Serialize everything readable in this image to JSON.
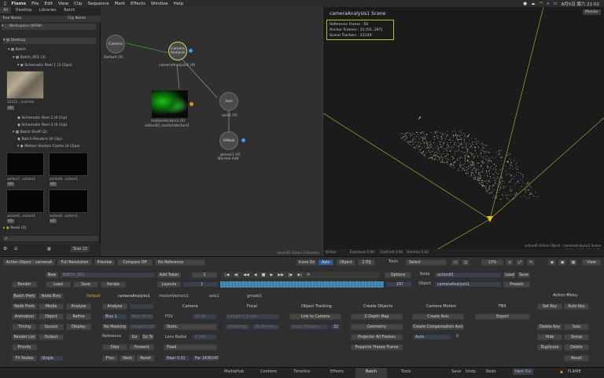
{
  "menubar": {
    "app": "Flame",
    "items": [
      "File",
      "Edit",
      "View",
      "Clip",
      "Sequence",
      "Mark",
      "Effects",
      "Window",
      "Help"
    ],
    "clock": "8月5日 周六 21:02"
  },
  "browser": {
    "tabs": [
      "All",
      "Desktop",
      "Libraries",
      "Batch"
    ],
    "col_tree": "Tree Name",
    "col_clip": "Clip Name",
    "workspace": "Workspace (WSW)",
    "desktop": "Desktop",
    "batch": "Batch",
    "batch_001": "Batch_001 (3)",
    "schematic_reel_1": "Schematic Reel 1 (3 Clips)",
    "clip_name_1": "22221...ircle-hd",
    "clip_tag_1": "HD",
    "schematic_reel_2": "Schematic Reel 2 (0 Clip)",
    "schematic_reel_3": "Schematic Reel 3 (0 Clip)",
    "batch_shelf": "Batch Shelf (2)",
    "batch_renders": "Batch Renders (0 Clip)",
    "motion_cache": "Motion Vectors Cache (4 Clips)",
    "thumbs": [
      {
        "label": "action7...ectors1",
        "tag": "HD"
      },
      {
        "label": "action8...ectors1",
        "tag": "HD"
      },
      {
        "label": "action6...ectors1",
        "tag": "HD"
      },
      {
        "label": "action6...ectors1",
        "tag": "HD"
      }
    ],
    "reels": "Reels (5)",
    "size_label": "Size 22"
  },
  "schematic": {
    "nodes": {
      "camera": "Camera",
      "camera_default": "Default (0)",
      "camera_analysis": "Camera Analysis",
      "camera_analysis_label": "cameraAnalysis1 (0)",
      "motion_label_1": "motionVectors1 (0)",
      "motion_label_2": "action81_motionVectors1",
      "axis": "Axis",
      "axis_label": "axis1 (0)",
      "gmask": "GMask",
      "gmask_label_1": "gmask1 (0)",
      "gmask_label_2": "Normal Add"
    },
    "footer": "action81 Action Schematic"
  },
  "viewer": {
    "title": "cameraAnalysis1 Scene",
    "monitor": "Monitor",
    "info_lines": [
      "Reference Frame : 50",
      "Anchor Frames : 21 [01..297]",
      "Scene Trackers : 22149"
    ],
    "footer_right_1": "action81 Action Object : cameraAnalysis1 Scene",
    "footer_right_2": "Shift • 1.98 | 13 | 1.71",
    "footer_left": "Action",
    "footer_exposure": "Exposure 0.00",
    "footer_contrast": "Contrast 1.00",
    "footer_gamma": "Gamma 1.00"
  },
  "toolbar": {
    "action_object": "Action Object : cameraA",
    "full_resolution": "Full Resolution",
    "preview": "Preview",
    "compare": "Compare Off",
    "no_reference": "No Reference",
    "icons_on": "Icons On",
    "axis": "Axis",
    "object": "Object",
    "two_d": "2 D/J",
    "tools": "Tools",
    "select": "Select",
    "zoom": "13%",
    "view": "View"
  },
  "batch_row": {
    "new": "New",
    "batch_name": "BATCH_001",
    "add_token": "Add Token",
    "frame": "1",
    "options": "Options",
    "node_label": "Node",
    "node_value": "action81",
    "load": "Load",
    "save": "Save",
    "render": "Render",
    "load2": "Load",
    "save2": "Save",
    "iterate": "Iterate",
    "layouts": "Layouts",
    "object_label": "Object",
    "object_value": "cameraAnalysis1",
    "presets": "Presets",
    "start_frame": "1",
    "end_frame": "297",
    "default_label": "Default"
  },
  "prefs_column": [
    "Batch Prefs",
    "Node Prefs",
    "Animation",
    "Timing",
    "Render List",
    "Priority",
    "FX Nodes"
  ],
  "prefs_col2": [
    "Node Bins",
    "Media",
    "Object",
    "Source",
    "Output"
  ],
  "prefs_col3": [
    "Analyse",
    "Refine",
    "Display"
  ],
  "fx_single": "Single",
  "tabs_row": {
    "tab_1": "cameraAnalysis1",
    "tab_2": "motionVectors1",
    "tab_3": "axis1",
    "tab_4": "gmask1"
  },
  "analysis": {
    "analyse": "Analyse",
    "bias": "Bias 1",
    "no_masking": "No Masking",
    "shape": "Shape 0.000",
    "reference": "Reference",
    "go": "Go",
    "goto": "Go To",
    "step": "Step",
    "forward": "Forward",
    "prev": "Prev",
    "next": "Next",
    "reset": "Reset",
    "max": "Max 10.00"
  },
  "camera": {
    "header": "Camera",
    "fov": "FOV",
    "fov_value": "42.00",
    "static": "Static",
    "lens_radial": "Lens Radial",
    "lens_value": "0.000",
    "fixed": "Fixed",
    "near": "Near 0.01",
    "far": "Far 2438245"
  },
  "focal": {
    "header": "Focal",
    "length": "Length 1.1 mm",
    "plate": "Plane Hgt",
    "plate_value": "36.00 mm"
  },
  "tracking": {
    "header": "Object Tracking",
    "link_camera": "Link to Camera",
    "input_trackers": "Input Trackers",
    "input_value": "32"
  },
  "create_objects": {
    "header": "Create Objects",
    "depth_map": "Z-Depth Map",
    "geometry": "Geometry",
    "projector_all": "Projector All Frames",
    "projector_freeze": "Projector Freeze Frame"
  },
  "camera_motion": {
    "header": "Camera Motion",
    "create_axis": "Create Axis",
    "create_comp": "Create Compensation Axis",
    "auto": "Auto",
    "auto_value": "0"
  },
  "fbx": {
    "header": "FBX",
    "export": "Export"
  },
  "action_menu": {
    "header": "Action Menu",
    "buttons": [
      "Set Key",
      "Auto Key",
      "Delete Key",
      "Solo",
      "Hide",
      "Group",
      "Duplicate",
      "Delete",
      "Reset"
    ]
  },
  "bottom_tabs": [
    "MediaHub",
    "Conform",
    "Timeline",
    "Effects",
    "Batch",
    "Tools"
  ],
  "bottom_right": {
    "save": "Save",
    "undo": "Undo",
    "redo": "Redo",
    "item": "Item 0+",
    "brand": "FLAME"
  }
}
